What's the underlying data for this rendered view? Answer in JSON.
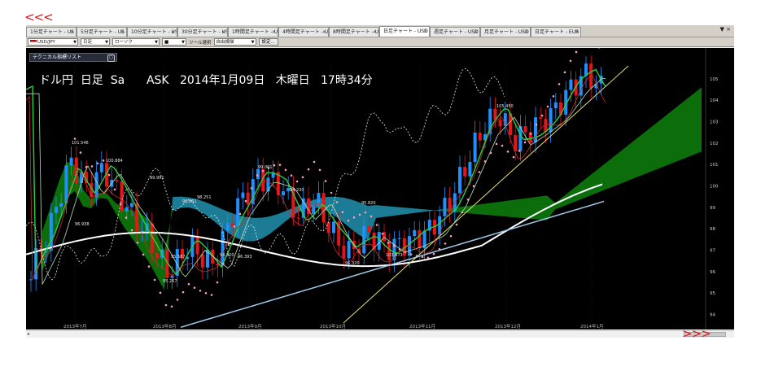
{
  "tabs": [
    {
      "label": "1分足チャート - US"
    },
    {
      "label": "5分足チャート - US"
    },
    {
      "label": "10分足チャート - US"
    },
    {
      "label": "30分足チャート - US"
    },
    {
      "label": "1時間足チャート - U"
    },
    {
      "label": "4時間足チャート - U"
    },
    {
      "label": "8時間足チャート - U"
    },
    {
      "label": "日足チャート - USD"
    },
    {
      "label": "週足チャート - USD"
    },
    {
      "label": "月足チャート - USD"
    },
    {
      "label": "日足チャート - EUR"
    }
  ],
  "active_tab": "日足チャート - USD",
  "tab_close_glyph": "×",
  "tabbar_controls": "▼ ×",
  "toolbar": {
    "symbol": "USD/JPY",
    "period": "日足",
    "chart_type": "ローソク",
    "line_style": "■",
    "tool_label": "ツール選択",
    "tool_value": "自由線描",
    "button": "設定..."
  },
  "tech_list_label": "テクニカル指標リスト",
  "headline": "ドル円  日足  Sa      ASK   2014年1月09日   木曜日   17時34分",
  "price_labels": [
    "101.546",
    "100.884",
    "99.991",
    "98.861",
    "98.251",
    "99.001",
    "94.230",
    "95.820",
    "96.938",
    "95.267",
    "95.587",
    "94.320",
    "96.393",
    "96.320",
    "103.873",
    "105.450"
  ],
  "y_axis_ticks": [
    "105",
    "104",
    "103",
    "102",
    "101",
    "100",
    "99",
    "98",
    "97",
    "96",
    "95",
    "94"
  ],
  "x_axis_ticks": [
    "2013年7月",
    "2013年8月",
    "2013年9月",
    "2013年10月",
    "2013年11月",
    "2013年12月",
    "2014年1月"
  ],
  "colors": {
    "bull": "#1e90ff",
    "bear": "#e8141a",
    "kumo_up": "#0c7a0c",
    "kumo_down": "#1f8aa6",
    "ma_white": "#ffffff",
    "ma_lightblue": "#9cc8e6",
    "ma_green": "#2ecc40",
    "trendline": "#e8e070",
    "sar": "#f4a0c0",
    "annotation_arrows": "#e0141e"
  },
  "annotation_arrows": {
    "left": "<<<",
    "right": ">>>"
  }
}
